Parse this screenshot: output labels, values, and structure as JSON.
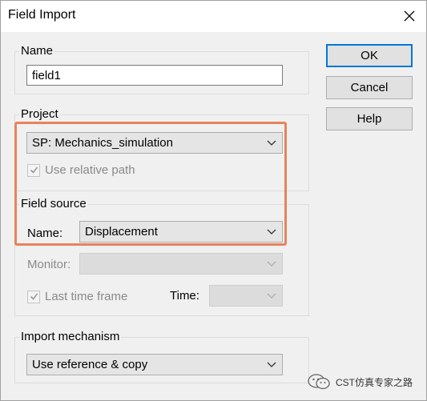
{
  "window": {
    "title": "Field Import",
    "close_icon": "close-icon"
  },
  "name_group": {
    "legend": "Name",
    "value": "field1"
  },
  "project_group": {
    "legend": "Project",
    "selected": "SP: Mechanics_simulation",
    "use_relative_path": {
      "label": "Use relative path",
      "checked": true,
      "enabled": false
    }
  },
  "field_source": {
    "legend": "Field source",
    "name_label": "Name:",
    "name_value": "Displacement",
    "monitor_label": "Monitor:",
    "monitor_value": "",
    "last_time_frame": {
      "label": "Last time frame",
      "checked": true,
      "enabled": false
    },
    "time_label": "Time:",
    "time_value": ""
  },
  "import_mechanism": {
    "legend": "Import mechanism",
    "selected": "Use reference & copy"
  },
  "buttons": {
    "ok": "OK",
    "cancel": "Cancel",
    "help": "Help"
  },
  "watermark": {
    "text": "CST仿真专家之路"
  },
  "colors": {
    "highlight": "#e8825a",
    "default_button_border": "#0078d7"
  }
}
